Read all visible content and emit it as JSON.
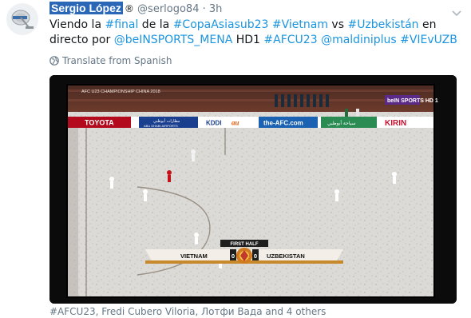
{
  "tweet": {
    "display_name": "Sergio López",
    "badge": "®",
    "handle": "@serlogo84",
    "separator": "·",
    "time": "3h",
    "text_parts": [
      {
        "t": "Viendo la ",
        "link": false
      },
      {
        "t": "#final",
        "link": true
      },
      {
        "t": " de la ",
        "link": false
      },
      {
        "t": "#CopaAsiasub23",
        "link": true
      },
      {
        "t": " ",
        "link": false
      },
      {
        "t": "#Vietnam",
        "link": true
      },
      {
        "t": " vs ",
        "link": false
      },
      {
        "t": "#Uzbekistán",
        "link": true
      },
      {
        "t": " en directo por ",
        "link": false
      },
      {
        "t": "@beINSPORTS_MENA",
        "link": true
      },
      {
        "t": " HD1 ",
        "link": false
      },
      {
        "t": "#AFCU23",
        "link": true
      },
      {
        "t": " ",
        "link": false
      },
      {
        "t": "@maldiniplus",
        "link": true
      },
      {
        "t": " ",
        "link": false
      },
      {
        "t": "#VIEvUZB",
        "link": true
      }
    ],
    "translate_label": "Translate from Spanish",
    "tags_line": "#AFCU23, Fredi Cubero Viloria, Лотфи Вада and 4 others"
  },
  "broadcast": {
    "banner_top": "AFC U23 CHAMPIONSHIP CHINA 2018",
    "network": "beIN SPORTS HD 1",
    "ads": [
      "TOYOTA",
      "KDDI",
      "au",
      "the-AFC.com",
      "KIRIN"
    ],
    "ad_arabic": "مطارات أبوظبي",
    "ad_arabic_2": "سياحة أبوظبي",
    "ad_abu_dhabi": "ABU DHABI AIRPORTS",
    "period": "FIRST HALF",
    "home_team": "VIETNAM",
    "home_score": "0",
    "away_team": "UZBEKISTAN",
    "away_score": "0"
  },
  "colors": {
    "accent": "#1b95e0",
    "name_highlight": "#2a68b7",
    "secondary_text": "#657786"
  }
}
